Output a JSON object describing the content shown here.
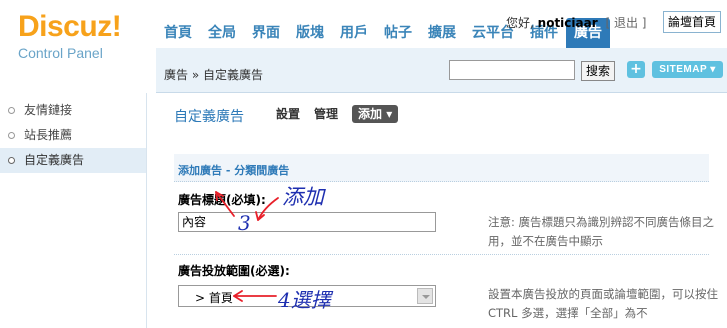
{
  "brand": {
    "logo_text": "Discuz!",
    "logo_sub": "Control Panel"
  },
  "userbar": {
    "greeting": "您好,",
    "username": "noticiaar",
    "bracket": "[ 退出 ]"
  },
  "forum_home_button": "論壇首頁",
  "nav": {
    "items": [
      {
        "label": "首頁"
      },
      {
        "label": "全局"
      },
      {
        "label": "界面"
      },
      {
        "label": "版塊"
      },
      {
        "label": "用戶"
      },
      {
        "label": "帖子"
      },
      {
        "label": "擴展"
      },
      {
        "label": "云平台"
      },
      {
        "label": "插件"
      },
      {
        "label": "廣告"
      }
    ],
    "active": "廣告"
  },
  "breadcrumb": {
    "text": "廣告 » 自定義廣告"
  },
  "search": {
    "value": "",
    "button": "搜索"
  },
  "toolbar": {
    "plus_label": "+",
    "sitemap_label": "SITEMAP ▾"
  },
  "sidebar": {
    "items": [
      {
        "label": "友情鏈接"
      },
      {
        "label": "站長推薦"
      },
      {
        "label": "自定義廣告"
      }
    ],
    "active_index": 2
  },
  "main": {
    "title": "自定義廣告",
    "tabs": [
      {
        "label": "設置"
      },
      {
        "label": "管理"
      },
      {
        "label": "添加 ▾"
      }
    ],
    "section_title": "添加廣告 - 分類間廣告",
    "field1": {
      "label": "廣告標題(必填):",
      "value": "內容",
      "note": "注意: 廣告標題只為識別辨認不同廣告條目之用，並不在廣告中顯示"
    },
    "field2": {
      "label": "廣告投放範圍(必選):",
      "selected": "> 首頁",
      "note": "設置本廣告投放的頁面或論壇範圍，可以按住 CTRL 多選，選擇「全部」為不"
    }
  },
  "annotations": {
    "add": "添加",
    "step3": "3",
    "step4": "4選擇"
  },
  "colors": {
    "brand_orange": "#f7a21b",
    "nav_blue": "#3b85b9",
    "active_tab": "#2e7ab8",
    "annotation_red": "#e8202a",
    "annotation_blue": "#1e2fb0",
    "sitemap_cyan": "#5fc1e0"
  }
}
